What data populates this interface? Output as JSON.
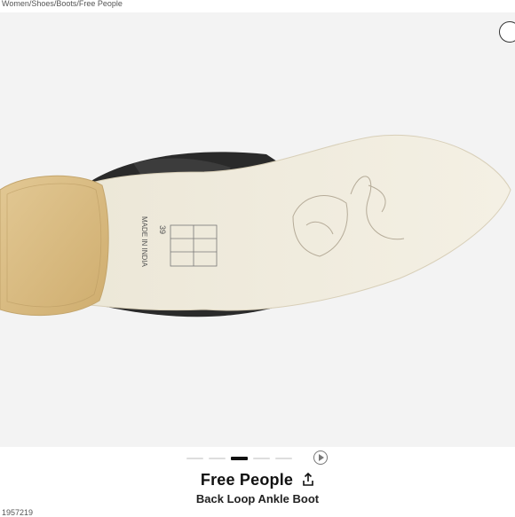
{
  "breadcrumb": "Women/Shoes/Boots/Free People",
  "gallery": {
    "sole_size_label": "39",
    "sole_origin_label": "MADE IN INDIA",
    "active_index": 2,
    "total_images": 6
  },
  "product": {
    "brand": "Free People",
    "name": "Back Loop Ankle Boot"
  },
  "sku": "1957219",
  "icons": {
    "share": "share-icon",
    "play": "play-icon",
    "corner": "circle-button-icon"
  }
}
